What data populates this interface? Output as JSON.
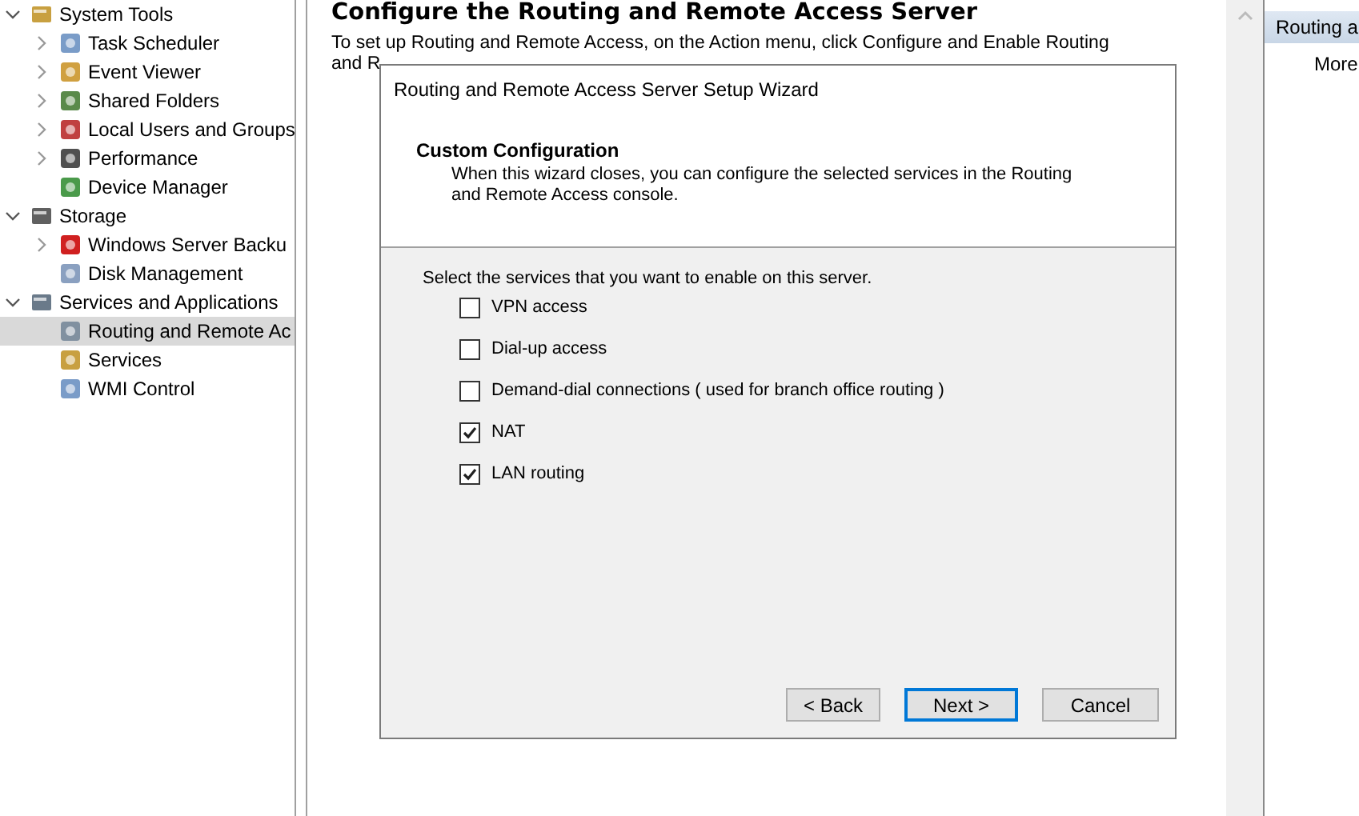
{
  "tree": [
    {
      "label": "System Tools",
      "expandable": true,
      "expanded": true,
      "selected": false,
      "children": [
        {
          "label": "Task Scheduler",
          "expandable": true,
          "expanded": false,
          "selected": false
        },
        {
          "label": "Event Viewer",
          "expandable": true,
          "expanded": false,
          "selected": false
        },
        {
          "label": "Shared Folders",
          "expandable": true,
          "expanded": false,
          "selected": false
        },
        {
          "label": "Local Users and Groups",
          "expandable": true,
          "expanded": false,
          "selected": false
        },
        {
          "label": "Performance",
          "expandable": true,
          "expanded": false,
          "selected": false
        },
        {
          "label": "Device Manager",
          "expandable": false,
          "selected": false
        }
      ]
    },
    {
      "label": "Storage",
      "expandable": true,
      "expanded": true,
      "selected": false,
      "children": [
        {
          "label": "Windows Server Backu",
          "expandable": true,
          "expanded": false,
          "selected": false
        },
        {
          "label": "Disk Management",
          "expandable": false,
          "selected": false
        }
      ]
    },
    {
      "label": "Services and Applications",
      "expandable": true,
      "expanded": true,
      "selected": false,
      "children": [
        {
          "label": "Routing and Remote Ac",
          "expandable": false,
          "selected": true
        },
        {
          "label": "Services",
          "expandable": false,
          "selected": false
        },
        {
          "label": "WMI Control",
          "expandable": false,
          "selected": false
        }
      ]
    }
  ],
  "content": {
    "heading": "Configure the Routing and Remote Access Server",
    "text_line_1": "To set up Routing and Remote Access, on the Action menu, click Configure and Enable Routing",
    "text_line_2": "and R"
  },
  "actions": {
    "header": "Routing a",
    "items": [
      "More"
    ]
  },
  "dialog": {
    "title": "Routing and Remote Access Server Setup Wizard",
    "header_title": "Custom Configuration",
    "header_text": "When this wizard closes, you can configure the selected services in the Routing and Remote Access console.",
    "prompt": "Select the services that you want to enable on this server.",
    "options": [
      {
        "label": "VPN access",
        "checked": false
      },
      {
        "label": "Dial-up access",
        "checked": false
      },
      {
        "label": "Demand-dial connections ( used for branch office routing )",
        "checked": false
      },
      {
        "label": "NAT",
        "checked": true
      },
      {
        "label": "LAN routing",
        "checked": true
      }
    ],
    "buttons": [
      {
        "label": "< Back",
        "default": false
      },
      {
        "label": "Next >",
        "default": true
      },
      {
        "label": "Cancel",
        "default": false
      }
    ]
  }
}
